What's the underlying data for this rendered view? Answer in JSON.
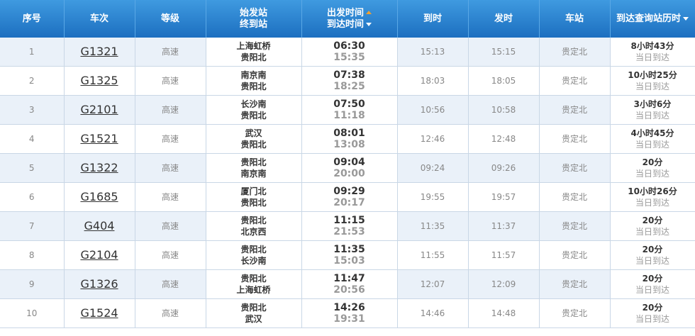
{
  "header": {
    "seq": "序号",
    "train": "车次",
    "grade": "等级",
    "start_station": "始发站",
    "end_station": "终到站",
    "dep_time": "出发时间",
    "arr_time": "到达时间",
    "arrive": "到时",
    "depart": "发时",
    "station": "车站",
    "duration": "到达查询站历时"
  },
  "rows": [
    {
      "seq": "1",
      "train": "G1321",
      "grade": "高速",
      "from": "上海虹桥",
      "to": "贵阳北",
      "dep": "06:30",
      "arr": "15:35",
      "arrive": "15:13",
      "depart": "15:15",
      "station": "贵定北",
      "dur": "8小时43分",
      "same": "当日到达"
    },
    {
      "seq": "2",
      "train": "G1325",
      "grade": "高速",
      "from": "南京南",
      "to": "贵阳北",
      "dep": "07:38",
      "arr": "18:25",
      "arrive": "18:03",
      "depart": "18:05",
      "station": "贵定北",
      "dur": "10小时25分",
      "same": "当日到达"
    },
    {
      "seq": "3",
      "train": "G2101",
      "grade": "高速",
      "from": "长沙南",
      "to": "贵阳北",
      "dep": "07:50",
      "arr": "11:18",
      "arrive": "10:56",
      "depart": "10:58",
      "station": "贵定北",
      "dur": "3小时6分",
      "same": "当日到达"
    },
    {
      "seq": "4",
      "train": "G1521",
      "grade": "高速",
      "from": "武汉",
      "to": "贵阳北",
      "dep": "08:01",
      "arr": "13:08",
      "arrive": "12:46",
      "depart": "12:48",
      "station": "贵定北",
      "dur": "4小时45分",
      "same": "当日到达"
    },
    {
      "seq": "5",
      "train": "G1322",
      "grade": "高速",
      "from": "贵阳北",
      "to": "南京南",
      "dep": "09:04",
      "arr": "20:00",
      "arrive": "09:24",
      "depart": "09:26",
      "station": "贵定北",
      "dur": "20分",
      "same": "当日到达"
    },
    {
      "seq": "6",
      "train": "G1685",
      "grade": "高速",
      "from": "厦门北",
      "to": "贵阳北",
      "dep": "09:29",
      "arr": "20:17",
      "arrive": "19:55",
      "depart": "19:57",
      "station": "贵定北",
      "dur": "10小时26分",
      "same": "当日到达"
    },
    {
      "seq": "7",
      "train": "G404",
      "grade": "高速",
      "from": "贵阳北",
      "to": "北京西",
      "dep": "11:15",
      "arr": "21:53",
      "arrive": "11:35",
      "depart": "11:37",
      "station": "贵定北",
      "dur": "20分",
      "same": "当日到达"
    },
    {
      "seq": "8",
      "train": "G2104",
      "grade": "高速",
      "from": "贵阳北",
      "to": "长沙南",
      "dep": "11:35",
      "arr": "15:03",
      "arrive": "11:55",
      "depart": "11:57",
      "station": "贵定北",
      "dur": "20分",
      "same": "当日到达"
    },
    {
      "seq": "9",
      "train": "G1326",
      "grade": "高速",
      "from": "贵阳北",
      "to": "上海虹桥",
      "dep": "11:47",
      "arr": "20:56",
      "arrive": "12:07",
      "depart": "12:09",
      "station": "贵定北",
      "dur": "20分",
      "same": "当日到达"
    },
    {
      "seq": "10",
      "train": "G1524",
      "grade": "高速",
      "from": "贵阳北",
      "to": "武汉",
      "dep": "14:26",
      "arr": "19:31",
      "arrive": "14:46",
      "depart": "14:48",
      "station": "贵定北",
      "dur": "20分",
      "same": "当日到达"
    }
  ],
  "colors": {
    "header_top": "#3f9ae0",
    "header_bottom": "#1c6fc0",
    "row_alt": "#eaf1f9",
    "sort_up": "#f0a030"
  },
  "icons": {
    "sort_asc": "triangle-up-icon",
    "sort_desc": "triangle-down-icon"
  }
}
